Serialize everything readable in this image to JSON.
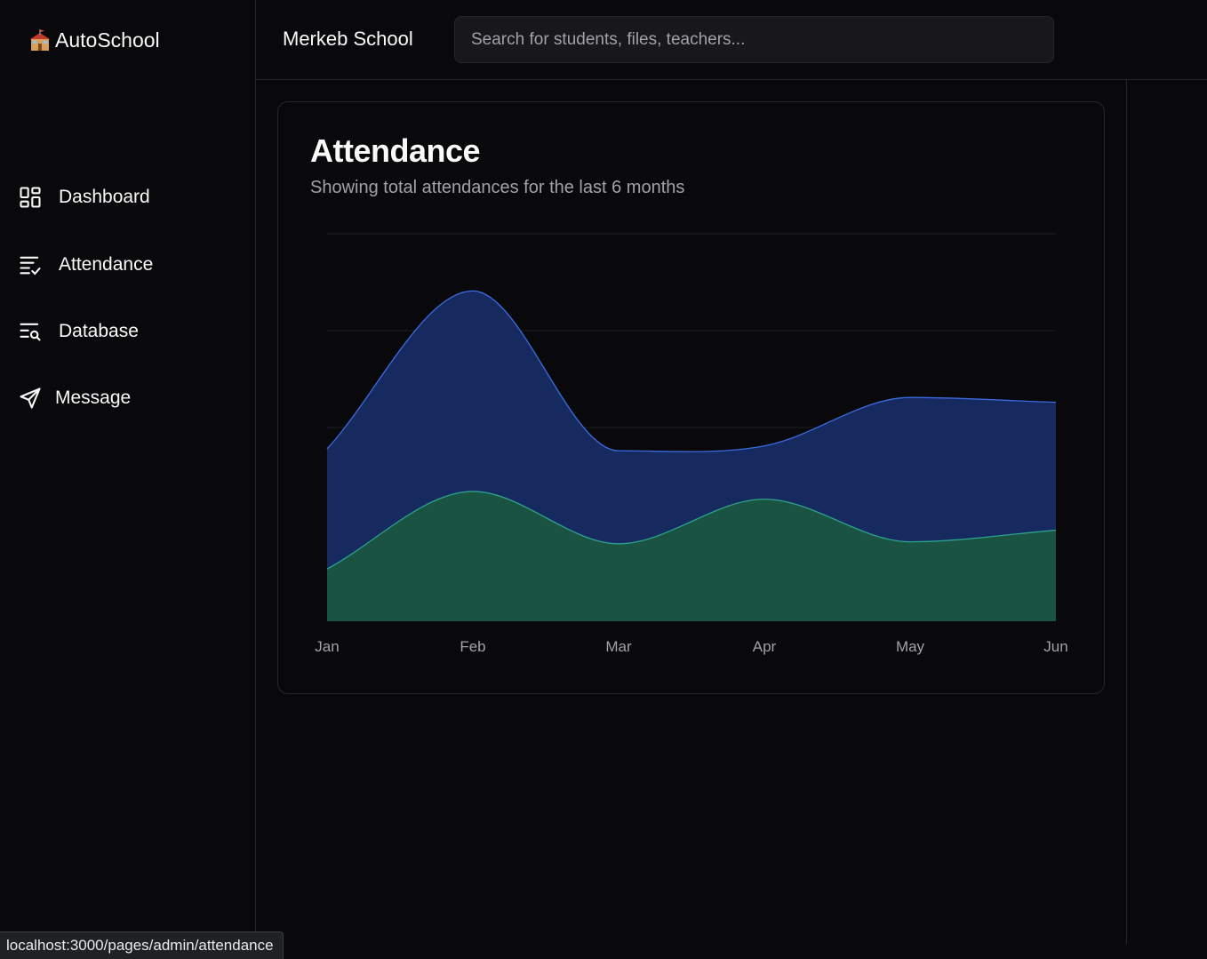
{
  "brand": {
    "name": "AutoSchool",
    "icon": "school-icon"
  },
  "sidebar": {
    "items": [
      {
        "label": "Dashboard",
        "icon": "dashboard-icon"
      },
      {
        "label": "Attendance",
        "icon": "list-check-icon"
      },
      {
        "label": "Database",
        "icon": "list-search-icon"
      },
      {
        "label": "Message",
        "icon": "send-icon"
      }
    ]
  },
  "header": {
    "school_name": "Merkeb School",
    "search_placeholder": "Search for students, files, teachers..."
  },
  "card": {
    "title": "Attendance",
    "subtitle": "Showing total attendances for the last 6 months"
  },
  "chart_data": {
    "type": "area",
    "categories": [
      "Jan",
      "Feb",
      "Mar",
      "Apr",
      "May",
      "Jun"
    ],
    "stacked": true,
    "grid": true,
    "ylim": [
      0,
      400
    ],
    "series": [
      {
        "values": [
          54,
          134,
          80,
          126,
          82,
          94
        ],
        "color": "#2ba38c"
      },
      {
        "values": [
          124,
          207,
          96,
          55,
          149,
          132
        ],
        "color": "#2a5bd7"
      }
    ]
  },
  "colors": {
    "background": "#09090b",
    "border": "#27272a",
    "muted_text": "#a1a1aa",
    "area_blue_fill": "#172a5f",
    "area_blue_stroke": "#3b6ae0",
    "area_green_fill": "#1b5342",
    "area_green_stroke": "#2ba38c"
  },
  "status_bar": {
    "url": "localhost:3000/pages/admin/attendance"
  }
}
